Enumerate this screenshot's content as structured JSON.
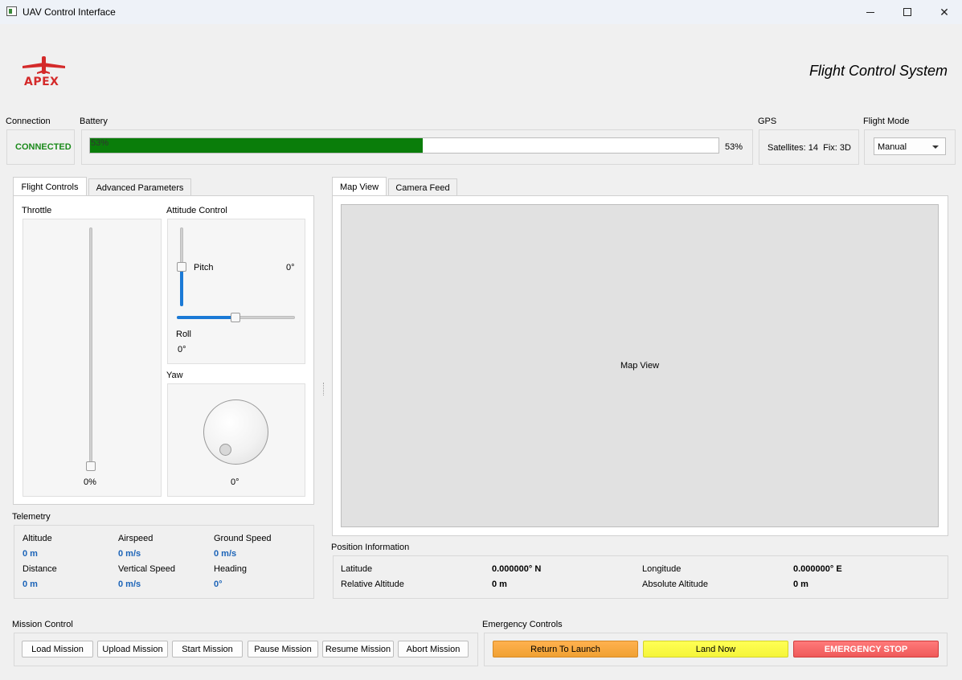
{
  "window": {
    "title": "UAV Control Interface"
  },
  "header": {
    "logo_text": "APEX",
    "system_title": "Flight Control System"
  },
  "status": {
    "connection_label": "Connection",
    "connection_value": "CONNECTED",
    "battery_label": "Battery",
    "battery_percent": 53,
    "battery_inner_text": "53%",
    "battery_text": "53%",
    "gps_label": "GPS",
    "gps_text": "Satellites: 14  Fix: 3D",
    "flight_mode_label": "Flight Mode",
    "flight_mode_value": "Manual"
  },
  "left_tabs": {
    "flight_controls": "Flight Controls",
    "advanced_parameters": "Advanced Parameters"
  },
  "flight_controls": {
    "throttle_label": "Throttle",
    "throttle_value": "0%",
    "throttle_level": 0,
    "attitude_label": "Attitude Control",
    "pitch_label": "Pitch",
    "pitch_value": "0°",
    "roll_label": "Roll",
    "roll_value": "0°",
    "yaw_label": "Yaw",
    "yaw_value": "0°"
  },
  "right_tabs": {
    "map_view": "Map View",
    "camera_feed": "Camera Feed"
  },
  "map": {
    "placeholder": "Map View"
  },
  "telemetry": {
    "title": "Telemetry",
    "altitude_label": "Altitude",
    "altitude_value": "0 m",
    "airspeed_label": "Airspeed",
    "airspeed_value": "0 m/s",
    "ground_speed_label": "Ground Speed",
    "ground_speed_value": "0 m/s",
    "distance_label": "Distance",
    "distance_value": "0 m",
    "vertical_speed_label": "Vertical Speed",
    "vertical_speed_value": "0 m/s",
    "heading_label": "Heading",
    "heading_value": "0°"
  },
  "position": {
    "title": "Position Information",
    "latitude_label": "Latitude",
    "latitude_value": "0.000000° N",
    "longitude_label": "Longitude",
    "longitude_value": "0.000000° E",
    "rel_alt_label": "Relative Altitude",
    "rel_alt_value": "0 m",
    "abs_alt_label": "Absolute Altitude",
    "abs_alt_value": "0 m"
  },
  "mission": {
    "title": "Mission Control",
    "load": "Load Mission",
    "upload": "Upload Mission",
    "start": "Start Mission",
    "pause": "Pause Mission",
    "resume": "Resume Mission",
    "abort": "Abort Mission"
  },
  "emergency": {
    "title": "Emergency Controls",
    "rtl": "Return To Launch",
    "land": "Land Now",
    "stop": "EMERGENCY STOP"
  }
}
